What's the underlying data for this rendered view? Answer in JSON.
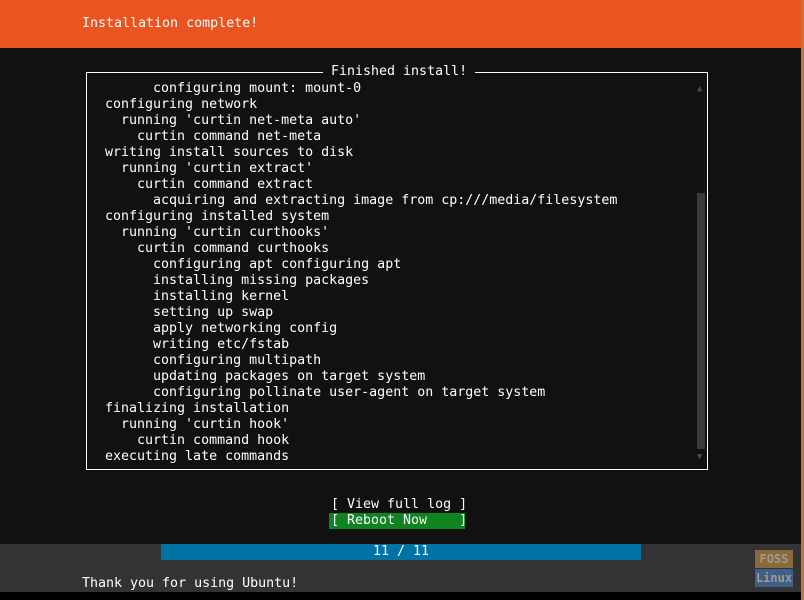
{
  "header": {
    "title": "Installation complete!"
  },
  "log_panel": {
    "title": "Finished install!",
    "lines": [
      "      configuring mount: mount-0",
      "configuring network",
      "  running 'curtin net-meta auto'",
      "    curtin command net-meta",
      "writing install sources to disk",
      "  running 'curtin extract'",
      "    curtin command extract",
      "      acquiring and extracting image from cp:///media/filesystem",
      "configuring installed system",
      "  running 'curtin curthooks'",
      "    curtin command curthooks",
      "      configuring apt configuring apt",
      "      installing missing packages",
      "      installing kernel",
      "      setting up swap",
      "      apply networking config",
      "      writing etc/fstab",
      "      configuring multipath",
      "      updating packages on target system",
      "      configuring pollinate user-agent on target system",
      "finalizing installation",
      "  running 'curtin hook'",
      "    curtin command hook",
      "executing late commands"
    ],
    "scroll_up_icon": "▲",
    "scroll_down_icon": "▼"
  },
  "actions": {
    "view_log_label": "[ View full log ]",
    "reboot_label": "[ Reboot Now    ]"
  },
  "footer": {
    "progress_text": "11 / 11",
    "progress_current": 11,
    "progress_total": 11,
    "message": "Thank you for using Ubuntu!"
  },
  "watermark": {
    "line1": "FOSS",
    "line2": "Linux"
  },
  "colors": {
    "header_bg": "#e95420",
    "terminal_bg": "#111111",
    "button_focus_bg": "#0e8420",
    "progress_bg": "#0073a5",
    "footer_bg": "#333333"
  }
}
